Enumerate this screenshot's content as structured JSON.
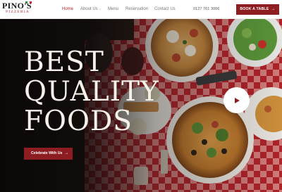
{
  "brand": {
    "name": "PINO'S",
    "sub": "PIZZERIA",
    "flag_colors": [
      "#2e8b3e",
      "#ffffff",
      "#c8242a"
    ]
  },
  "nav": {
    "items": [
      {
        "label": "Home",
        "active": true
      },
      {
        "label": "About Us",
        "has_dropdown": true
      },
      {
        "label": "Menu"
      },
      {
        "label": "Reservation"
      },
      {
        "label": "Contact Us"
      }
    ],
    "phone": "0127 761 3006",
    "book_label": "BOOK A TABLE"
  },
  "hero": {
    "headline": [
      "BEST",
      "QUALITY",
      "FOODS"
    ],
    "cta_label": "Celebrate With Us",
    "play_icon": "play-icon"
  },
  "colors": {
    "accent": "#8e1d21",
    "active_link": "#b3282d",
    "headline": "#f5f1ea"
  }
}
